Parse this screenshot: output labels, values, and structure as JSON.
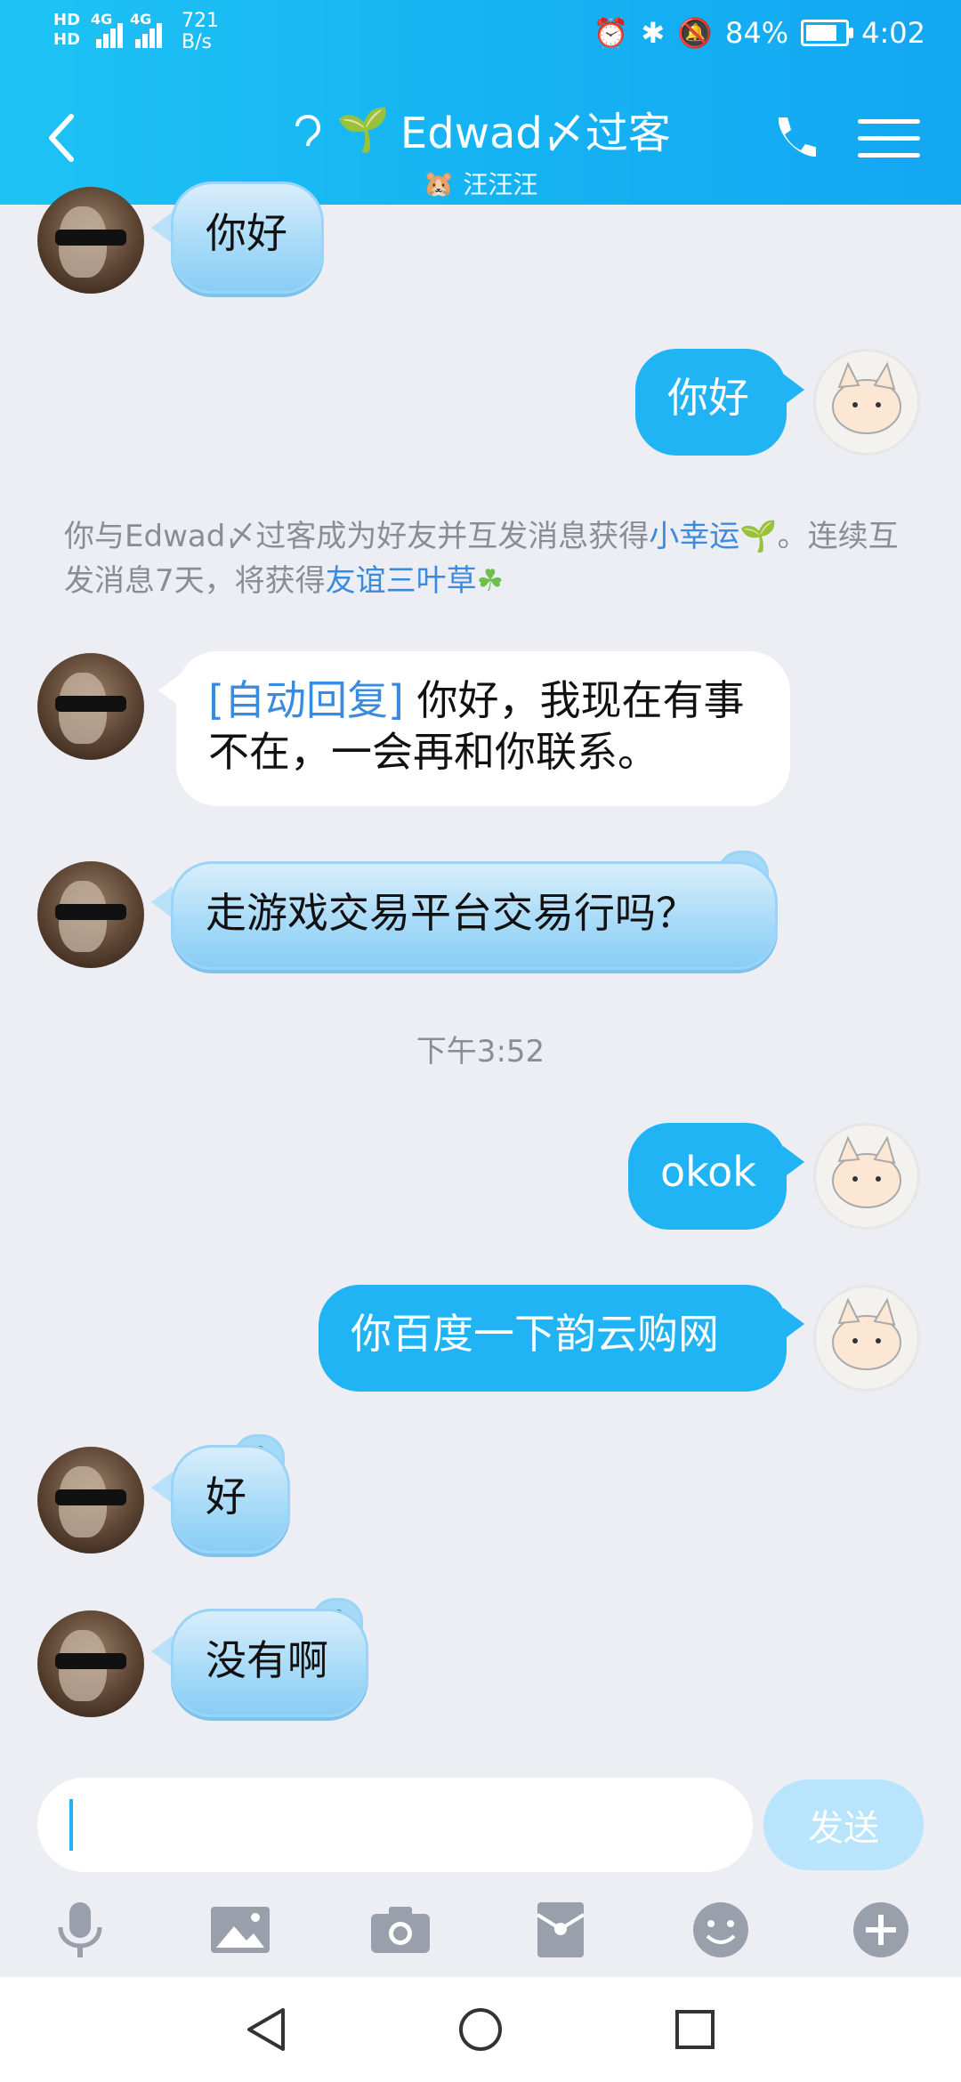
{
  "status": {
    "hd1": "HD",
    "hd2": "HD",
    "net1": "4G",
    "net2": "4G",
    "rate_value": "721",
    "rate_unit": "B/s",
    "battery": "84%",
    "battery_level": 0.84,
    "time": "4:02"
  },
  "header": {
    "title": "Edwad〆过客",
    "subtitle": "汪汪汪"
  },
  "chat": {
    "m1": "你好",
    "m2": "你好",
    "system_pre": "你与Edwad〆过客成为好友并互发消息获得",
    "system_link1": "小幸运",
    "system_mid": "。连续互发消息7天，将获得",
    "system_link2": "友谊三叶草",
    "auto_tag": "[自动回复]",
    "auto_text": " 你好，我现在有事不在，一会再和你联系。",
    "m4": "走游戏交易平台交易行吗？",
    "time_label": "下午3:52",
    "m5": "okok",
    "m6": "你百度一下韵云购网",
    "m7": "好",
    "m8": "没有啊"
  },
  "input": {
    "send": "发送"
  },
  "icons": [
    "back-icon",
    "ear-icon",
    "sprout-icon",
    "call-icon",
    "menu-icon",
    "mic-icon",
    "image-icon",
    "camera-icon",
    "red-packet-icon",
    "emoji-icon",
    "plus-icon",
    "nav-back-icon",
    "nav-home-icon",
    "nav-recent-icon"
  ]
}
